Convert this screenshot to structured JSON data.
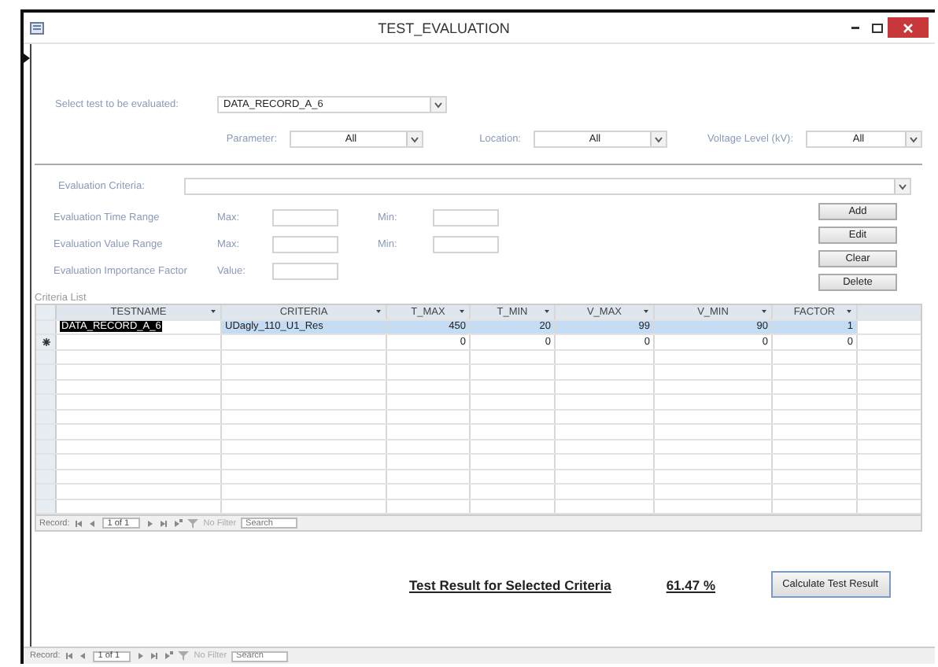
{
  "window": {
    "title": "TEST_EVALUATION"
  },
  "test_select": {
    "label": "Select test to be evaluated:",
    "value": "DATA_RECORD_A_6"
  },
  "filters": [
    {
      "label": "Parameter:",
      "value": "All"
    },
    {
      "label": "Location:",
      "value": "All"
    },
    {
      "label": "Voltage Level (kV):",
      "value": "All"
    }
  ],
  "evaluation_criteria": {
    "label": "Evaluation Criteria:"
  },
  "ranges": [
    {
      "label": "Evaluation Time Range",
      "fields": [
        "Max:",
        "Min:"
      ]
    },
    {
      "label": "Evaluation Value Range",
      "fields": [
        "Max:",
        "Min:"
      ]
    },
    {
      "label": "Evaluation Importance Factor",
      "fields": [
        "Value:"
      ]
    }
  ],
  "buttons": [
    "Add",
    "Edit",
    "Clear",
    "Delete"
  ],
  "criteria_list": {
    "label": "Criteria List",
    "columns": [
      "TESTNAME",
      "CRITERIA",
      "T_MAX",
      "T_MIN",
      "V_MAX",
      "V_MIN",
      "FACTOR"
    ],
    "rows": [
      {
        "kind": "record",
        "selected": true,
        "cells": [
          "DATA_RECORD_A_6",
          "UDagly_110_U1_Res",
          "450",
          "20",
          "99",
          "90",
          "1"
        ]
      },
      {
        "kind": "new",
        "selected": false,
        "cells": [
          "",
          "",
          "0",
          "0",
          "0",
          "0",
          "0"
        ]
      }
    ],
    "navigator": {
      "label": "Record:",
      "position": "1 of 1",
      "filter": "No Filter",
      "search_placeholder": "Search"
    }
  },
  "result": {
    "label": "Test Result for Selected Criteria",
    "value": "61.47 %",
    "button": "Calculate Test Result"
  },
  "form_navigator": {
    "label": "Record:",
    "position": "1 of 1",
    "filter": "No Filter",
    "search_placeholder": "Search"
  }
}
